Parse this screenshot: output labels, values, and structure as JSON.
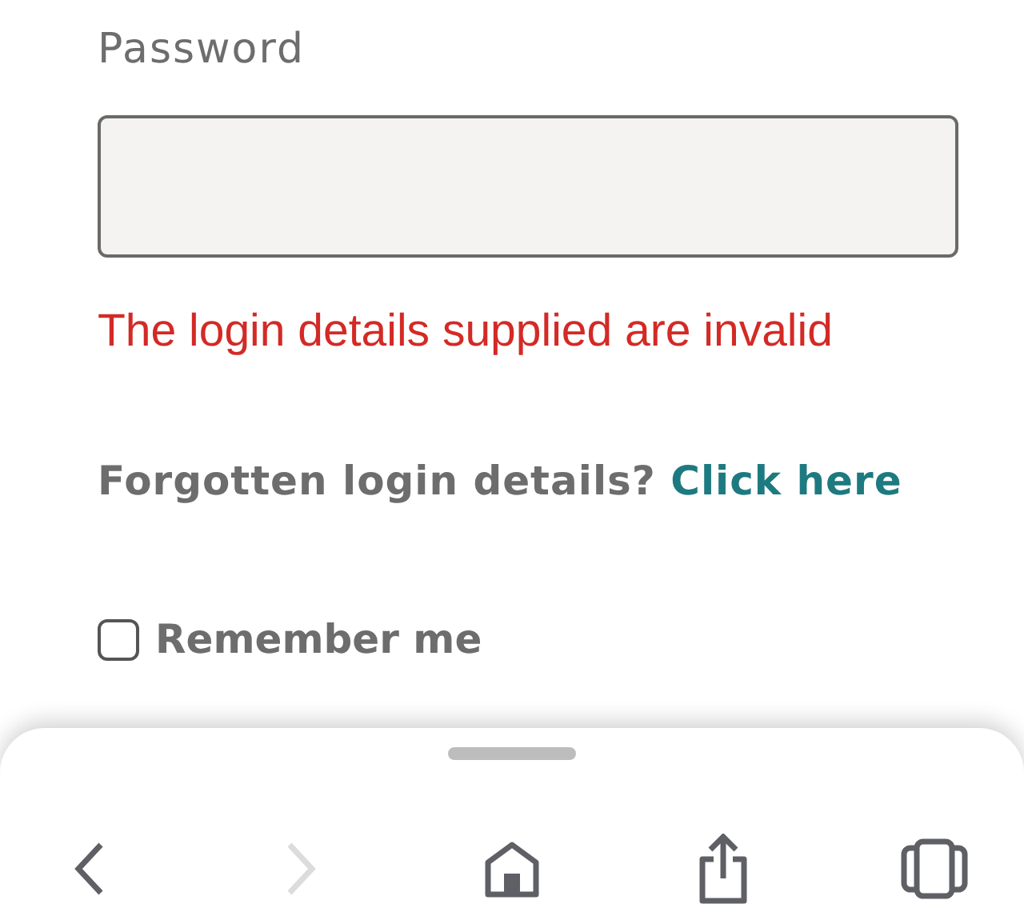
{
  "password_field": {
    "label": "Password"
  },
  "error_message": "The login details supplied are invalid",
  "forgotten": {
    "text": "Forgotten login details?",
    "link": "Click here"
  },
  "remember_me": {
    "label": "Remember me",
    "checked": false
  },
  "browser_toolbar": [
    {
      "kind": "back",
      "disabled": false
    },
    {
      "kind": "forward",
      "disabled": true
    },
    {
      "kind": "home",
      "disabled": false
    },
    {
      "kind": "share",
      "disabled": false
    },
    {
      "kind": "tabs",
      "disabled": false
    }
  ]
}
